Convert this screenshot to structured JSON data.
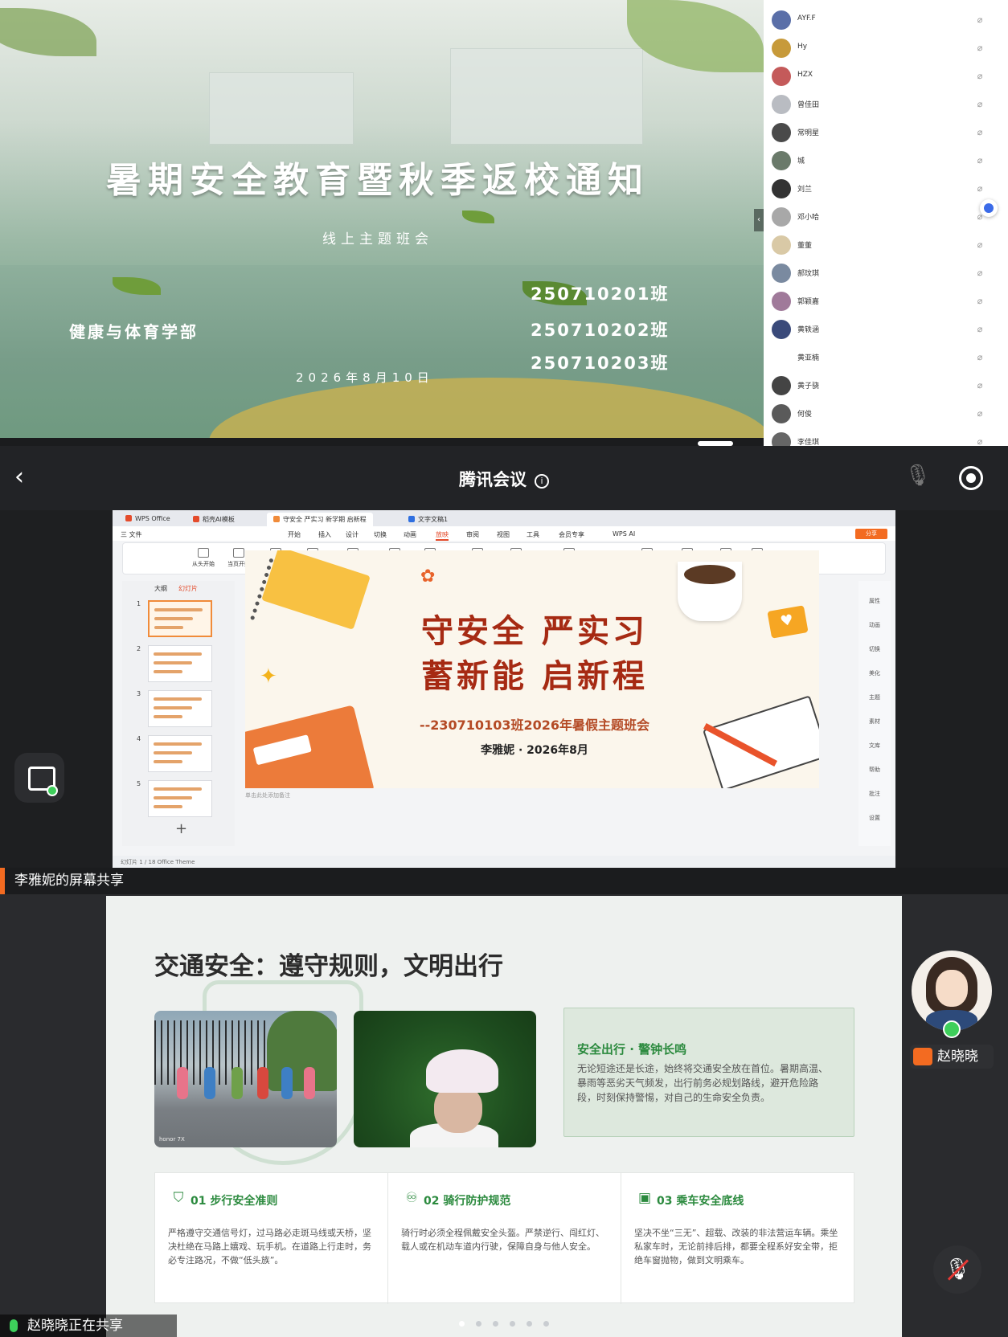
{
  "top_slide": {
    "title": "暑期安全教育暨秋季返校通知",
    "subtitle": "线上主题班会",
    "department": "健康与体育学部",
    "classes": [
      "250710201班",
      "250710202班",
      "250710203班"
    ],
    "date": "2026年8月10日"
  },
  "participants": [
    {
      "name": "AYF.F",
      "color": "#5a6fa8"
    },
    {
      "name": "Hy",
      "color": "#c79a3a"
    },
    {
      "name": "HZX",
      "color": "#c45a5a"
    },
    {
      "name": "曾佳田",
      "color": "#b9bcc2"
    },
    {
      "name": "常明星",
      "color": "#4a4a4a"
    },
    {
      "name": "城",
      "color": "#6a7a6a"
    },
    {
      "name": "刘兰",
      "color": "#333333"
    },
    {
      "name": "邓小哈",
      "color": "#a8a8a8"
    },
    {
      "name": "董董",
      "color": "#d9c9a6"
    },
    {
      "name": "郝玟琪",
      "color": "#7a8aa0"
    },
    {
      "name": "郭颖嘉",
      "color": "#a07a9a"
    },
    {
      "name": "黄轶涵",
      "color": "#3a4a7a"
    },
    {
      "name": "黄亚楠",
      "color": "#ffffff"
    },
    {
      "name": "黄子骁",
      "color": "#444444"
    },
    {
      "name": "何俊",
      "color": "#5a5a5a"
    },
    {
      "name": "李佳琪",
      "color": "#666666"
    }
  ],
  "header": {
    "title": "腾讯会议",
    "info_icon": "i",
    "back_icon": "‹",
    "mic_icon": "🎙"
  },
  "wps": {
    "tabs": [
      {
        "label": "WPS Office",
        "color": "#e44b2b"
      },
      {
        "label": "稻壳AI模板",
        "color": "#e44b2b"
      },
      {
        "label": "守安全 严实习 新学期 启新程",
        "color": "#f08b3a"
      },
      {
        "label": "文字文稿1",
        "color": "#2f6fe0"
      }
    ],
    "menu": [
      "三 文件",
      "开始",
      "插入",
      "设计",
      "切换",
      "动画",
      "放映",
      "审阅",
      "视图",
      "工具",
      "会员专享",
      "WPS AI"
    ],
    "active_menu": "放映",
    "share_button": "分享",
    "ribbon": [
      "从头开始",
      "当页开始",
      "演讲者视图",
      "自定义放映",
      "放映设置",
      "隐藏幻灯片",
      "演讲备注",
      "AI 检查校对",
      "AI 讲PPT",
      "显示演讲者视图",
      "排练计时",
      "手机遥控",
      "屏幕录制",
      "倒计时"
    ],
    "thumb_tabs": [
      "大纲",
      "幻灯片"
    ],
    "thumb_numbers": [
      "1",
      "2",
      "3",
      "4",
      "5"
    ],
    "add_slide": "+",
    "slide_title_line1": "守安全  严实习",
    "slide_title_line2": "蓄新能  启新程",
    "slide_subtitle": "--230710103班2026年暑假主题班会",
    "slide_author": "李雅妮 · 2026年8月",
    "side_rail": [
      "属性",
      "动画",
      "切换",
      "美化",
      "主题",
      "素材",
      "文库",
      "帮助",
      "批注",
      "设置"
    ],
    "notes_hint": "单击此处添加备注",
    "status_text": "幻灯片 1 / 18    Office Theme"
  },
  "share_label": "李雅妮的屏幕共享",
  "slide2": {
    "title": "交通安全：遵守规则，文明出行",
    "photo1_tag": "honor 7X",
    "card_title": "安全出行 · 警钟长鸣",
    "card_body": "无论短途还是长途，始终将交通安全放在首位。暑期高温、暴雨等恶劣天气频发，出行前务必规划路线，避开危险路段，时刻保持警惕，对自己的生命安全负责。",
    "rules": [
      {
        "icon": "⛉",
        "title": "01 步行安全准则",
        "body": "严格遵守交通信号灯，过马路必走斑马线或天桥，坚决杜绝在马路上嬉戏、玩手机。在道路上行走时，务必专注路况，不做“低头族”。"
      },
      {
        "icon": "♾",
        "title": "02 骑行防护规范",
        "body": "骑行时必须全程佩戴安全头盔。严禁逆行、闯红灯、载人或在机动车道内行驶，保障自身与他人安全。"
      },
      {
        "icon": "▣",
        "title": "03 乘车安全底线",
        "body": "坚决不坐“三无”、超载、改装的非法营运车辆。乘坐私家车时，无论前排后排，都要全程系好安全带，拒绝车窗抛物，做到文明乘车。"
      }
    ]
  },
  "speaker": {
    "name": "赵晓晓",
    "sharing_label": "赵晓晓正在共享"
  },
  "page_dots": 6,
  "active_dot": 0,
  "colors": {
    "accent_orange": "#f36b21",
    "green": "#2b8a3e",
    "mic_green": "#3ecf5b"
  }
}
